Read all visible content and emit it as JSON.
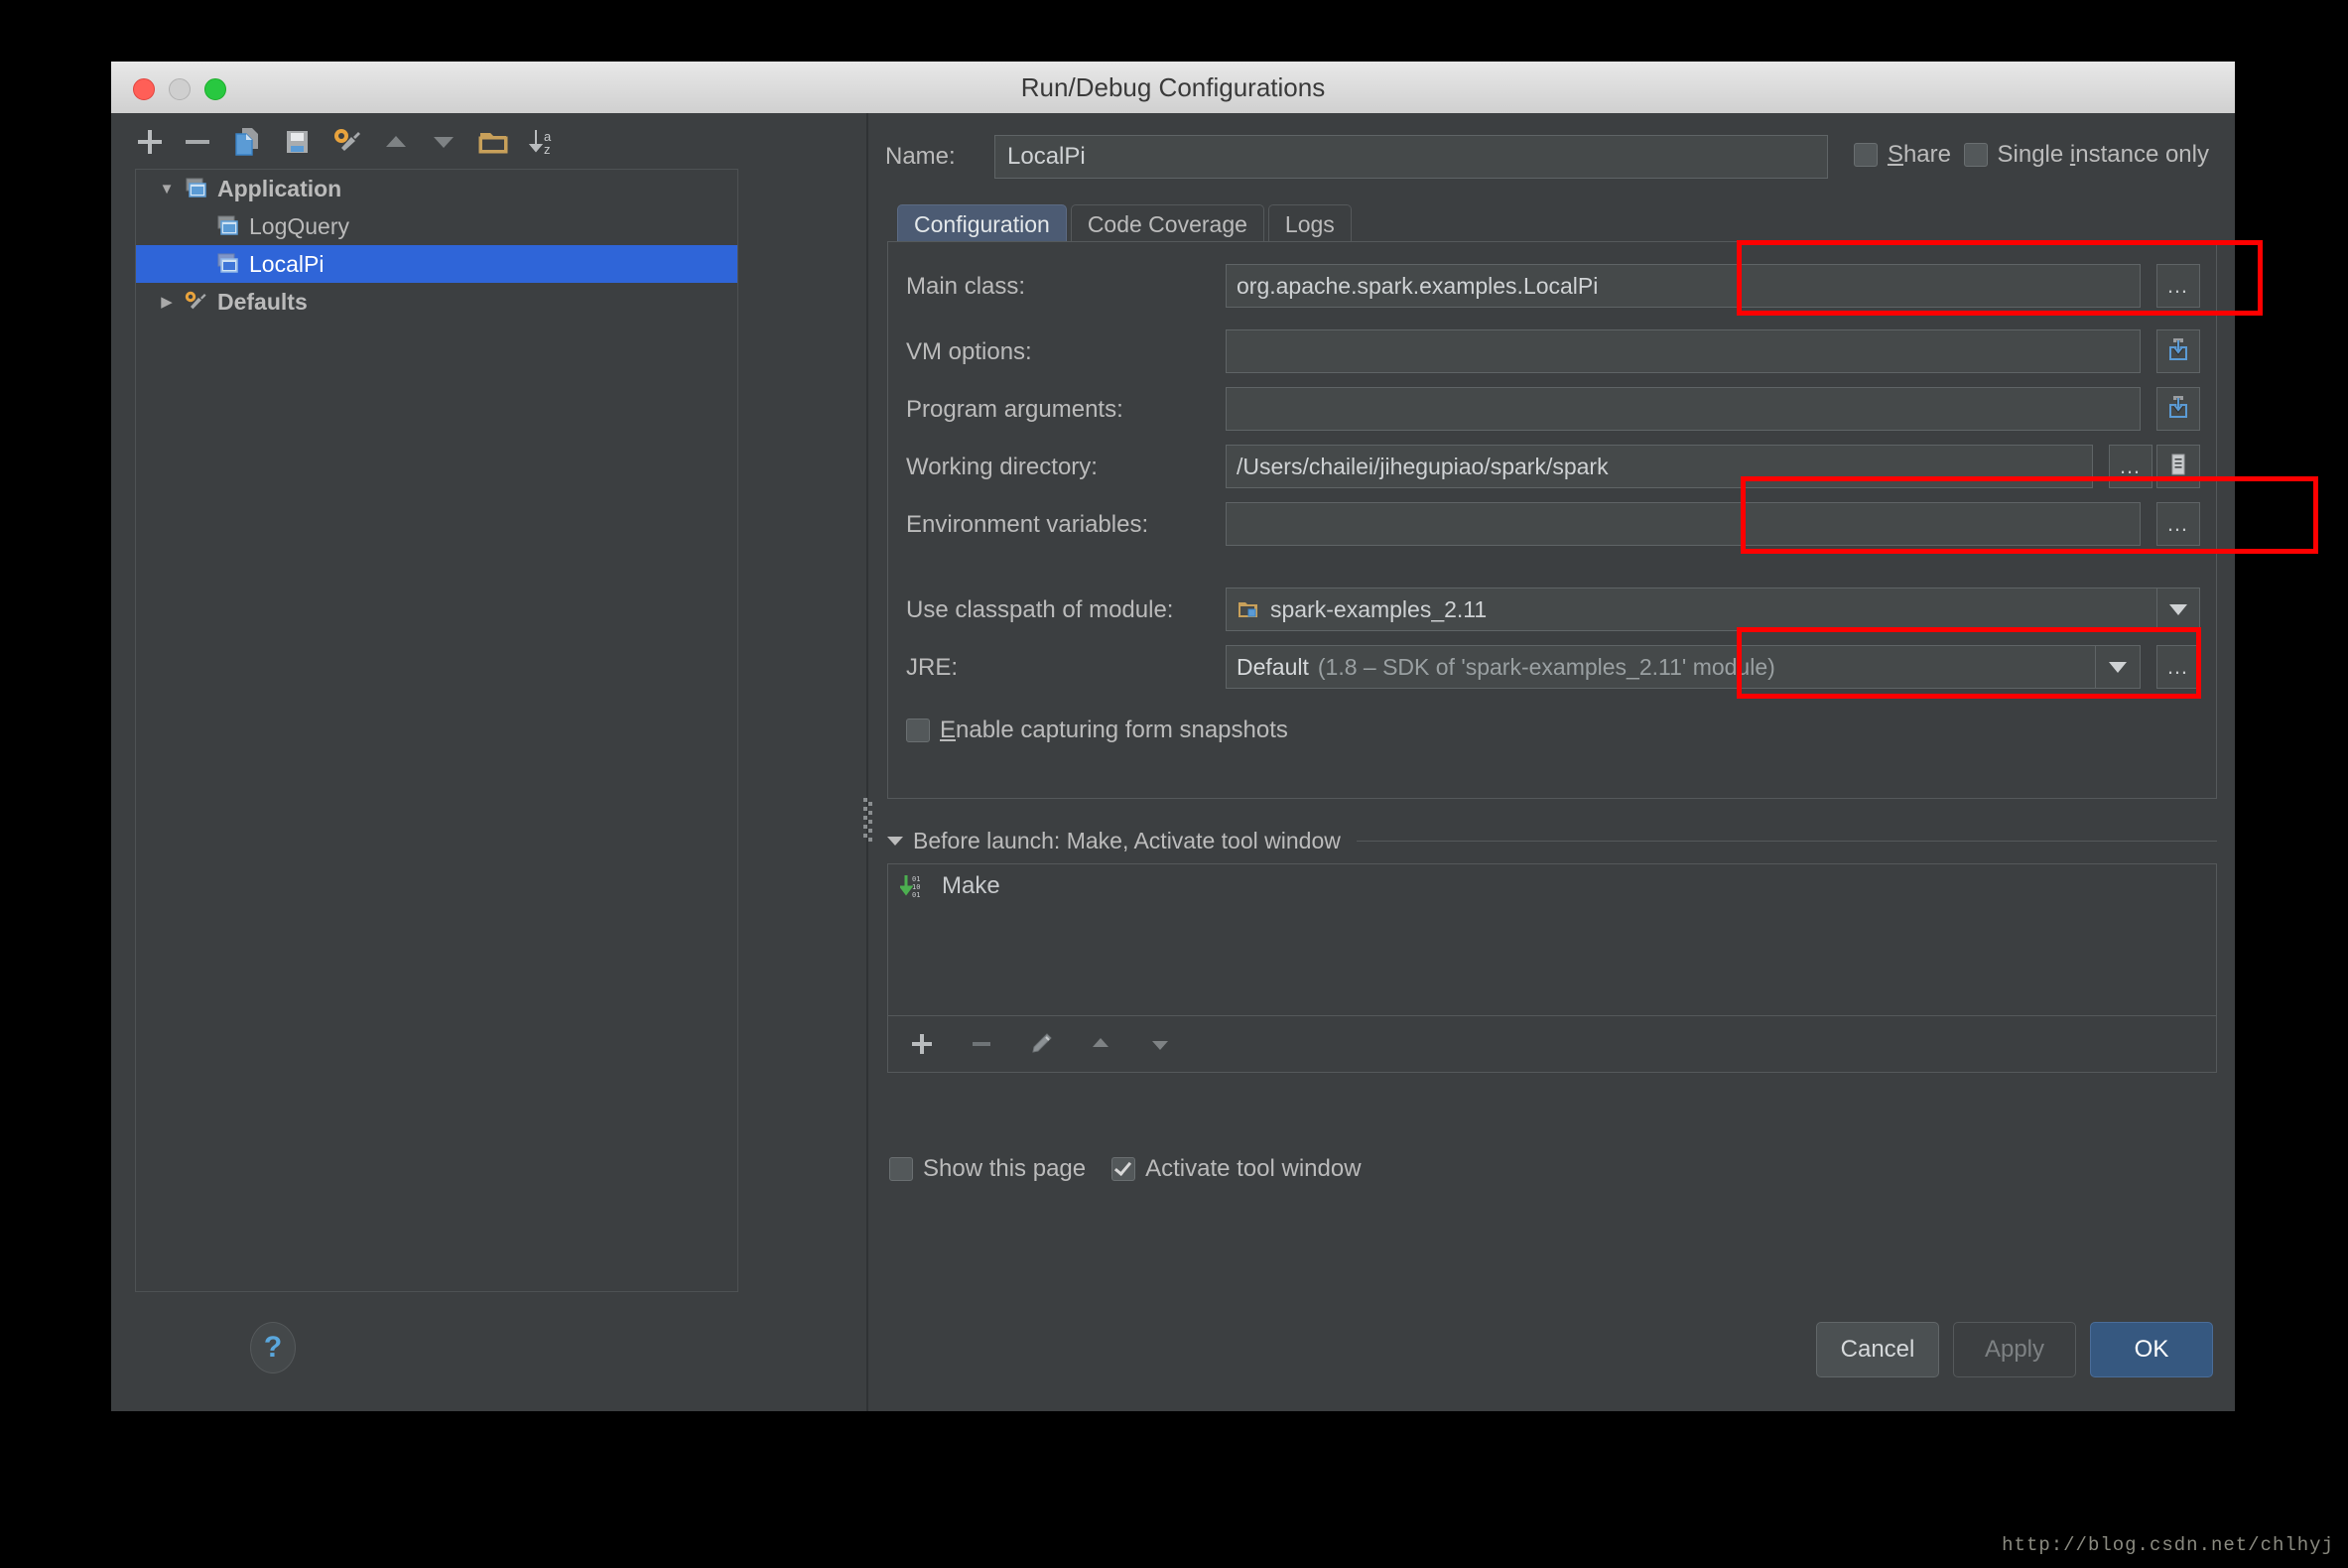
{
  "window": {
    "title": "Run/Debug Configurations",
    "traffic_lights": [
      "close",
      "minimize",
      "zoom"
    ]
  },
  "left_toolbar": {
    "icons": [
      "add-icon",
      "remove-icon",
      "copy-icon",
      "save-icon",
      "edit-defaults-icon",
      "move-up-icon",
      "move-down-icon",
      "folder-icon",
      "sort-alphabetically-icon"
    ]
  },
  "tree": {
    "rows": [
      {
        "label": "Application",
        "level": 1,
        "expanded": true,
        "icon": "application-icon",
        "selected": false,
        "bold": true
      },
      {
        "label": "LogQuery",
        "level": 2,
        "expanded": null,
        "icon": "application-icon",
        "selected": false,
        "bold": false
      },
      {
        "label": "LocalPi",
        "level": 2,
        "expanded": null,
        "icon": "application-icon",
        "selected": true,
        "bold": false
      },
      {
        "label": "Defaults",
        "level": 1,
        "expanded": false,
        "icon": "defaults-wrench-icon",
        "selected": false,
        "bold": true
      }
    ]
  },
  "help_button": {
    "glyph": "?"
  },
  "name_row": {
    "label": "Name:",
    "value": "LocalPi",
    "placeholder": "",
    "share_label": "Share",
    "share_checked": false,
    "single_instance_label": "Single instance only",
    "single_instance_checked": false
  },
  "tabs": [
    {
      "label": "Configuration",
      "active": true
    },
    {
      "label": "Code Coverage",
      "active": false
    },
    {
      "label": "Logs",
      "active": false
    }
  ],
  "fields": {
    "main_class": {
      "label": "Main class:",
      "value": "org.apache.spark.examples.LocalPi",
      "button": "…"
    },
    "vm_options": {
      "label": "VM options:",
      "value": "",
      "button": "expand-editor-icon"
    },
    "program_arguments": {
      "label": "Program arguments:",
      "value": "",
      "button": "expand-editor-icon"
    },
    "working_directory": {
      "label": "Working directory:",
      "value": "/Users/chailei/jihegupiao/spark/spark",
      "button": "…",
      "button2": "macro-list-icon"
    },
    "environment_variables": {
      "label": "Environment variables:",
      "value": "",
      "button": "…"
    },
    "module": {
      "label": "Use classpath of module:",
      "value": "spark-examples_2.11",
      "icon": "module-folder-icon",
      "dropdown": "chevron-down-icon"
    },
    "jre": {
      "label": "JRE:",
      "value_primary": "Default",
      "value_secondary": "(1.8 – SDK of 'spark-examples_2.11' module)",
      "dropdown": "chevron-down-icon",
      "button": "…"
    },
    "form_snapshots": {
      "label": "Enable capturing form snapshots",
      "checked": false
    }
  },
  "before_launch": {
    "header": "Before launch: Make, Activate tool window",
    "items": [
      {
        "label": "Make",
        "icon": "make-build-icon"
      }
    ],
    "toolbar_icons": [
      "add-icon",
      "remove-icon",
      "edit-icon",
      "move-up-icon",
      "move-down-icon"
    ],
    "show_this_page": {
      "label": "Show this page",
      "checked": false
    },
    "activate_tool_window": {
      "label": "Activate tool window",
      "checked": true
    }
  },
  "footer": {
    "cancel": "Cancel",
    "apply": "Apply",
    "ok": "OK"
  },
  "watermark": "http://blog.csdn.net/chlhyj",
  "colors": {
    "window_bg": "#3c3f41",
    "field_bg": "#45494a",
    "selection_blue": "#2f65d8",
    "tab_active": "#4c5b73",
    "primary_button": "#365880",
    "annotation_red": "#ff0000",
    "make_icon_green": "#4caf50",
    "folder_orange": "#c8a05a"
  }
}
